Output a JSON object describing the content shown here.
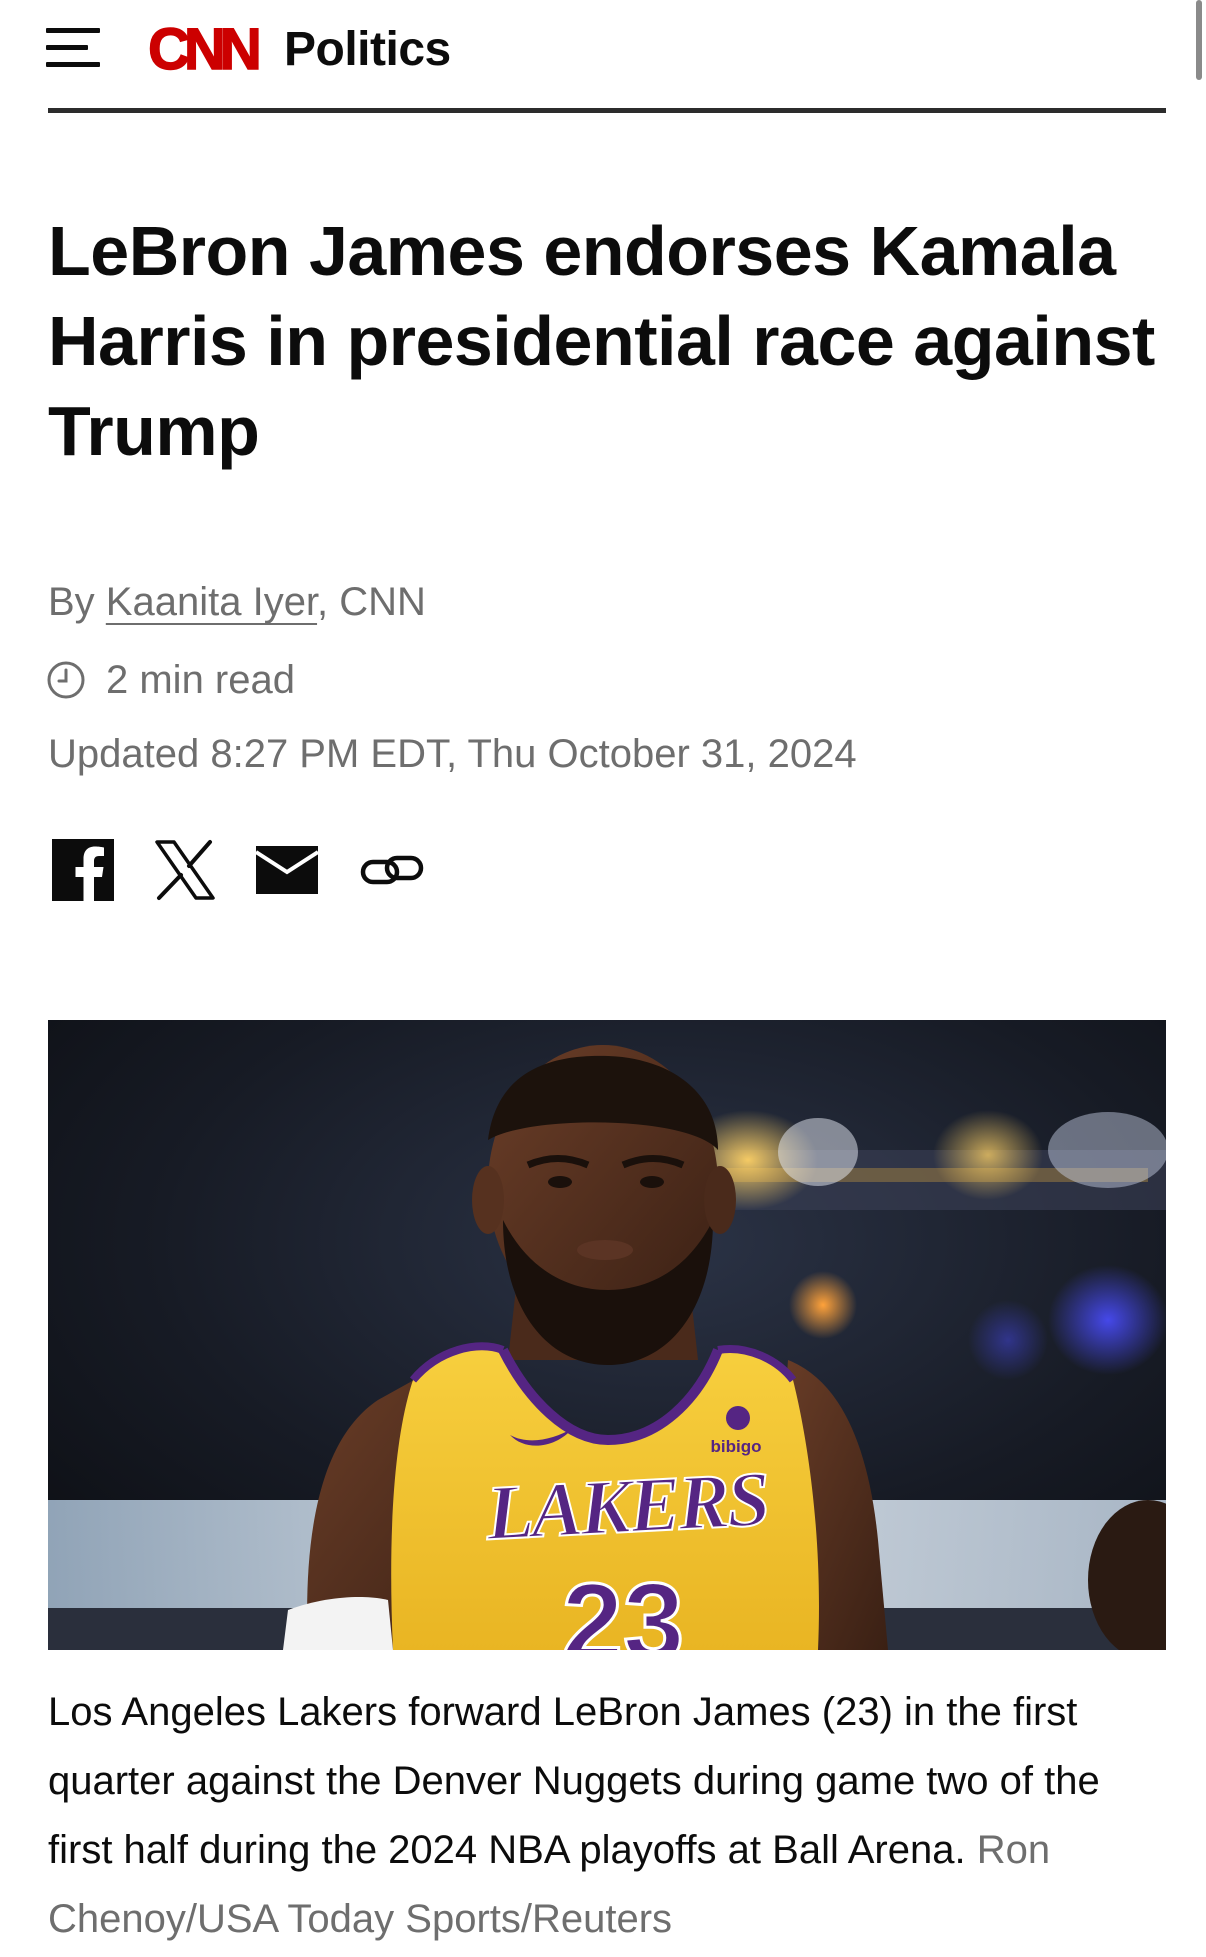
{
  "header": {
    "brand": "CNN",
    "section": "Politics"
  },
  "article": {
    "headline": "LeBron James endorses Kamala Harris in presidential race against Trump",
    "byline_prefix": "By ",
    "author": "Kaanita Iyer",
    "byline_suffix": ", CNN",
    "read_time": "2 min read",
    "updated": "Updated 8:27 PM EDT, Thu October 31, 2024"
  },
  "share": {
    "icons": [
      "facebook-icon",
      "x-icon",
      "email-icon",
      "link-icon"
    ]
  },
  "image": {
    "jersey_text": "LAKERS",
    "jersey_number": "23",
    "sponsor": "bibigo",
    "caption": "Los Angeles Lakers forward LeBron James (23) in the first quarter against the Denver Nuggets during game two of the first half during the 2024 NBA playoffs at Ball Arena.",
    "credit": "Ron Chenoy/USA Today Sports/Reuters"
  },
  "colors": {
    "cnn_red": "#cc0000",
    "text": "#0c0c0c",
    "muted": "#6e6e6e",
    "jersey_gold": "#f5c531",
    "jersey_purple": "#552583"
  }
}
